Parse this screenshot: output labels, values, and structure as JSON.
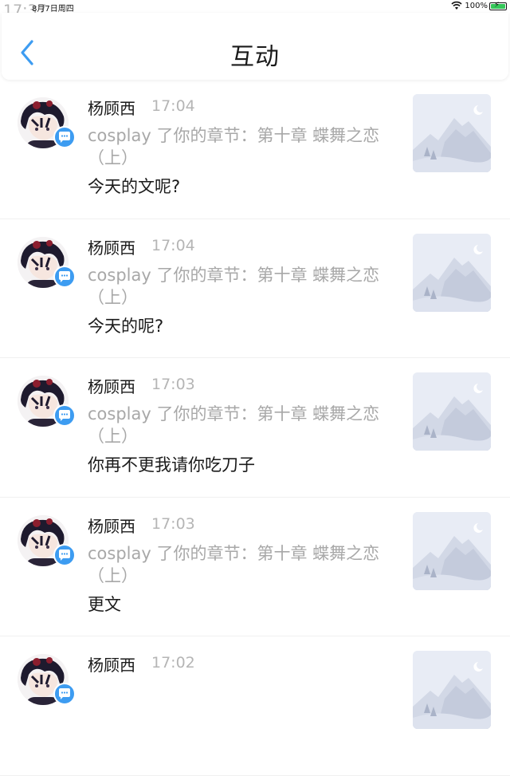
{
  "status_bar": {
    "time": "17:37",
    "date": "8月7日周四",
    "battery_text": "100%",
    "battery_level": 1.0
  },
  "header": {
    "title": "互动",
    "back_icon": "chevron-left-icon"
  },
  "colors": {
    "accent": "#3d9cf1",
    "muted": "#a8a8a8",
    "divider": "#f0f0f0"
  },
  "items": [
    {
      "name": "杨顾西",
      "time": "17:04",
      "ref": "cosplay 了你的章节：第十章  蝶舞之恋（上）",
      "message": "今天的文呢?"
    },
    {
      "name": "杨顾西",
      "time": "17:04",
      "ref": "cosplay 了你的章节：第十章  蝶舞之恋（上）",
      "message": "今天的呢?"
    },
    {
      "name": "杨顾西",
      "time": "17:03",
      "ref": "cosplay 了你的章节：第十章  蝶舞之恋（上）",
      "message": "你再不更我请你吃刀子"
    },
    {
      "name": "杨顾西",
      "time": "17:03",
      "ref": "cosplay 了你的章节：第十章  蝶舞之恋（上）",
      "message": "更文"
    },
    {
      "name": "杨顾西",
      "time": "17:02",
      "ref": "",
      "message": ""
    }
  ]
}
